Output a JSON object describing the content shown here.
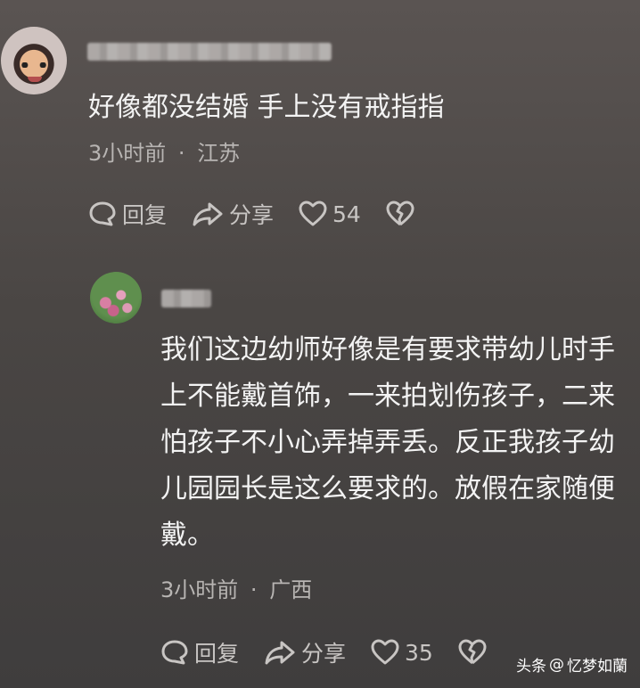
{
  "comment": {
    "text": "好像都没结婚 手上没有戒指指",
    "time": "3小时前",
    "location": "江苏",
    "actions": {
      "reply": "回复",
      "share": "分享",
      "likes": "54"
    }
  },
  "reply": {
    "text": "我们这边幼师好像是有要求带幼儿时手上不能戴首饰，一来拍划伤孩子，二来怕孩子不小心弄掉弄丢。反正我孩子幼儿园园长是这么要求的。放假在家随便戴。",
    "time": "3小时前",
    "location": "广西",
    "actions": {
      "reply": "回复",
      "share": "分享",
      "likes": "35"
    }
  },
  "separator": "·",
  "watermark": {
    "brand": "头条",
    "at": "@",
    "author": "忆梦如蘭"
  }
}
